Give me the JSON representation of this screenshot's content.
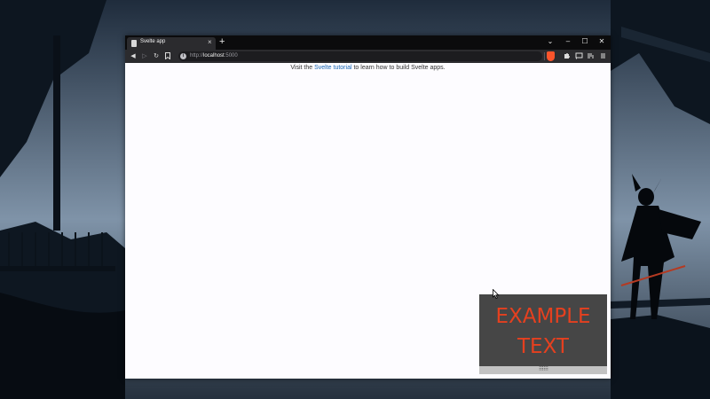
{
  "browser": {
    "tab": {
      "title": "Svelte app",
      "close_glyph": "×"
    },
    "new_tab_glyph": "+",
    "window_controls": {
      "menu": "⌄",
      "minimize": "–",
      "maximize": "☐",
      "close": "✕"
    },
    "nav": {
      "back": "◀",
      "forward": "▷",
      "reload": "↻",
      "bookmark": "🔖"
    },
    "address": {
      "protocol": "http://",
      "host": "localhost",
      "port": ":5000",
      "info_glyph": "i"
    },
    "extensions": [
      "brave-shields-icon",
      "puzzle-icon",
      "cast-icon",
      "reading-list-icon",
      "menu-icon"
    ]
  },
  "page": {
    "intro_prefix": "Visit the ",
    "link_text": "Svelte tutorial",
    "intro_suffix": " to learn how to build Svelte apps."
  },
  "overlay": {
    "line1": "EXAMPLE",
    "line2": "TEXT",
    "grip": "⠿⠿⠿",
    "text_color": "#e5401f",
    "background": "#464646"
  }
}
